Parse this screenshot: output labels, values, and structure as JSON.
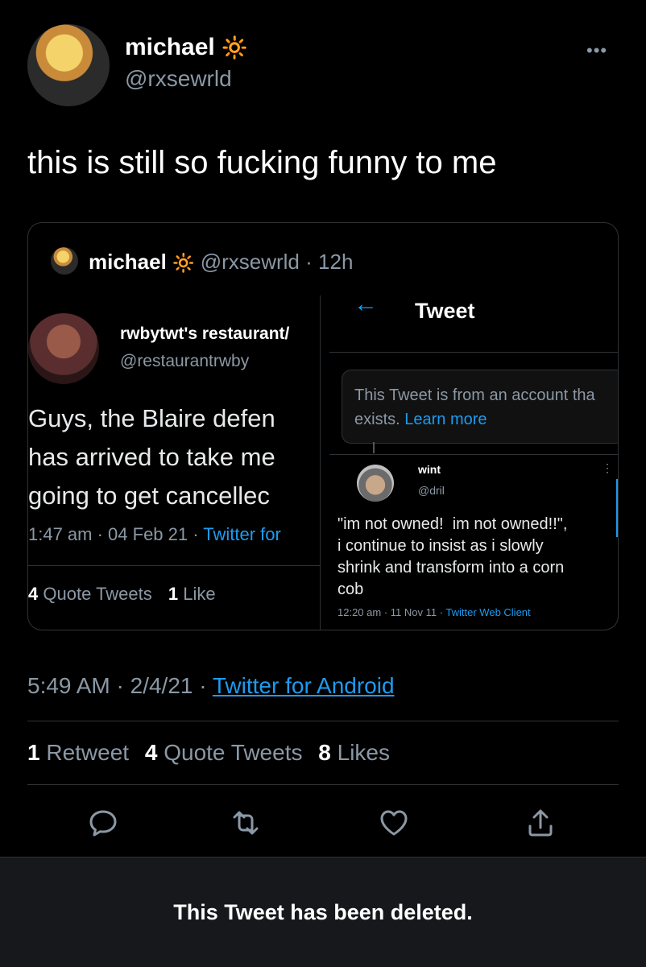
{
  "header": {
    "display_name": "michael",
    "handle": "@rxsewrld",
    "emoji": "🔆",
    "more": "•••"
  },
  "tweet": {
    "text": "this is still so fucking funny to me",
    "meta": {
      "time": "5:49 AM",
      "sep1": "·",
      "date": "2/4/21",
      "sep2": "·",
      "source": "Twitter for Android"
    },
    "stats": {
      "retweets_num": "1",
      "retweets_label": "Retweet",
      "quotes_num": "4",
      "quotes_label": "Quote Tweets",
      "likes_num": "8",
      "likes_label": "Likes"
    }
  },
  "quoted": {
    "name": "michael",
    "emoji": "🔆",
    "handle": "@rxsewrld",
    "sep": "·",
    "age": "12h",
    "left": {
      "name": "rwbytwt's restaurant/",
      "handle": "@restaurantrwby",
      "line1": "Guys, the Blaire defen",
      "line2": "has arrived to take me",
      "line3": "going to get cancellec",
      "meta": "1:47 am · 04 Feb 21 · ",
      "source": "Twitter for",
      "quotes_num": "4",
      "quotes_label": "Quote Tweets",
      "likes_num": "1",
      "likes_label": "Like"
    },
    "right": {
      "back": "←",
      "title": "Tweet",
      "notice_line1": "This Tweet is from an account tha",
      "notice_line2": "exists.",
      "notice_link": "Learn more",
      "name": "wint",
      "handle": "@dril",
      "text1": "\"im not owned!  im not owned!!\",",
      "text2": "i continue to insist as i slowly",
      "text3": "shrink and transform into a corn",
      "text4": "cob",
      "meta": "12:20 am · 11 Nov 11 · ",
      "source": "Twitter Web Client",
      "more": "⋮"
    }
  },
  "actions": [
    "reply-icon",
    "retweet-icon",
    "like-icon",
    "share-icon"
  ],
  "banner": {
    "text": "This Tweet has been deleted."
  },
  "colors": {
    "background": "#000000",
    "link": "#1d9bf0",
    "muted": "#8b98a5",
    "divider": "#2f3336"
  }
}
